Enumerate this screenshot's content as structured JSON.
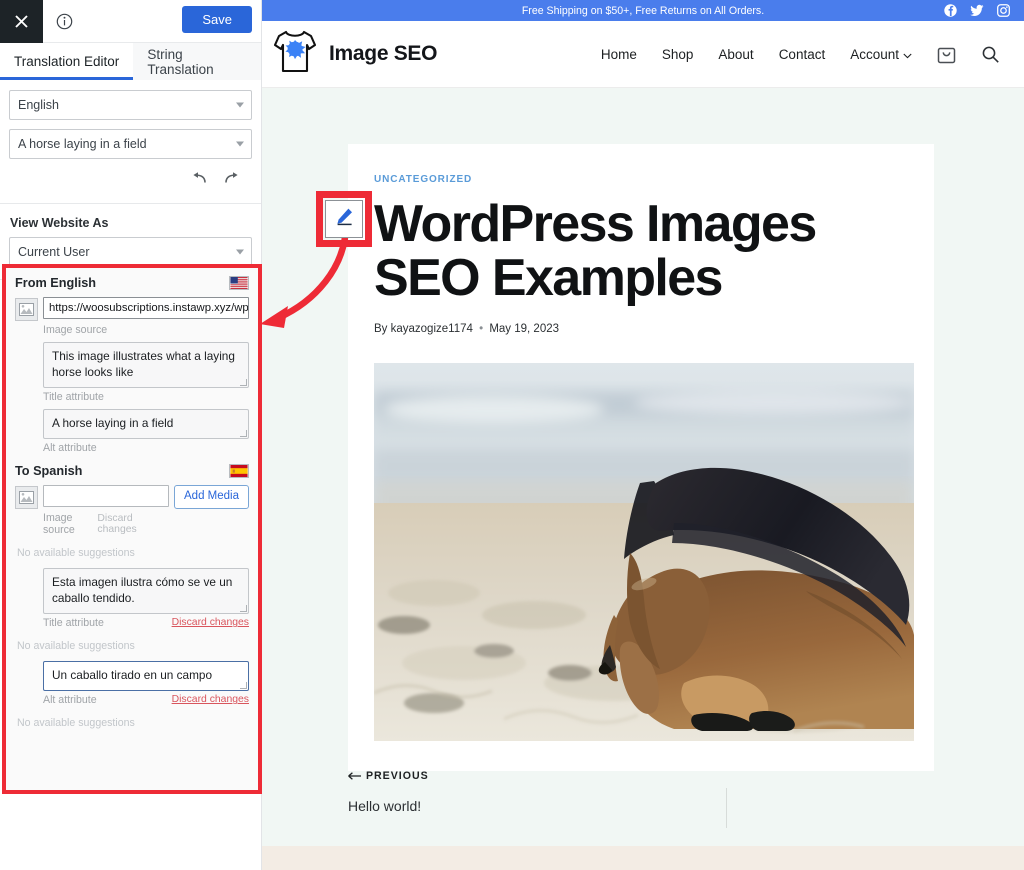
{
  "sidebar": {
    "close_icon": "close-icon",
    "info_icon": "info-icon",
    "save_label": "Save",
    "tabs": [
      {
        "label": "Translation Editor",
        "active": true
      },
      {
        "label": "String Translation",
        "active": false
      }
    ],
    "language_select": {
      "value": "English",
      "icon": "chevron-down-icon"
    },
    "string_select": {
      "value": "A horse laying in a field",
      "icon": "chevron-down-icon"
    },
    "history": {
      "undo_icon": "undo-icon",
      "redo_icon": "redo-icon"
    },
    "view_website_as": {
      "label": "View Website As",
      "value": "Current User"
    },
    "source_panel": {
      "heading": "From English",
      "flag": "us-flag-icon",
      "image_source": {
        "value": "https://woosubscriptions.instawp.xyz/wp-conten",
        "label": "Image source",
        "icon": "image-icon"
      },
      "title_attribute": {
        "value": "This image illustrates what a laying horse looks like",
        "label": "Title attribute"
      },
      "alt_attribute": {
        "value": "A horse laying in a field",
        "label": "Alt attribute"
      }
    },
    "target_panel": {
      "heading": "To Spanish",
      "flag": "es-flag-icon",
      "add_media_label": "Add Media",
      "image_source": {
        "value": "",
        "placeholder": "",
        "label": "Image source",
        "discard_label": "Discard changes",
        "discard_enabled": false,
        "suggestions": "No available suggestions",
        "icon": "image-icon"
      },
      "title_attribute": {
        "value": "Esta imagen ilustra cómo se ve un caballo tendido.",
        "label": "Title attribute",
        "discard_label": "Discard changes",
        "discard_enabled": true,
        "suggestions": "No available suggestions"
      },
      "alt_attribute": {
        "value": "Un caballo tirado en un campo",
        "label": "Alt attribute",
        "discard_label": "Discard changes",
        "discard_enabled": true,
        "suggestions": "No available suggestions"
      }
    }
  },
  "preview": {
    "promo_bar": {
      "text": "Free Shipping on $50+, Free Returns on All Orders.",
      "socials": [
        "facebook-icon",
        "twitter-icon",
        "instagram-icon"
      ]
    },
    "header": {
      "logo_icon": "tshirt-logo-icon",
      "brand": "Image SEO",
      "nav": [
        {
          "label": "Home"
        },
        {
          "label": "Shop"
        },
        {
          "label": "About"
        },
        {
          "label": "Contact"
        },
        {
          "label": "Account",
          "caret": true
        }
      ],
      "cart_icon": "shopping-bag-icon",
      "search_icon": "search-icon"
    },
    "post": {
      "category": "UNCATEGORIZED",
      "title": "WordPress Images SEO Examples",
      "author_prefix": "By",
      "author": "kayazogize1174",
      "separator": "•",
      "date": "May 19, 2023",
      "image_alt": "A horse laying in a field"
    },
    "post_nav": {
      "prev_label": "PREVIOUS",
      "prev_arrow": "arrow-left-icon",
      "prev_title": "Hello world!"
    },
    "edit_badge_icon": "pencil-edit-icon"
  },
  "colors": {
    "accent_blue": "#2a66d9",
    "promo_blue": "#4a7dec",
    "highlight_red": "#ee2b36",
    "page_bg": "#f1f7f4",
    "footer_strip": "#f3ece4"
  }
}
